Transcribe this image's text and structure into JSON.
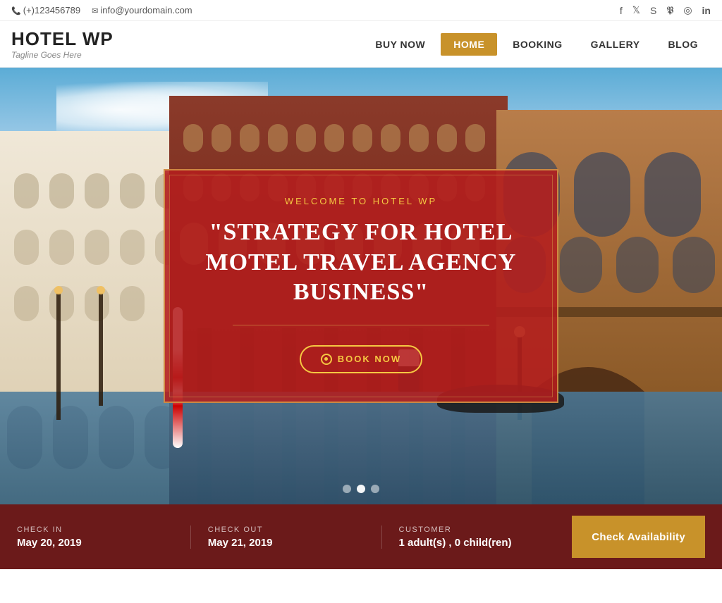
{
  "topbar": {
    "phone": "(+)123456789",
    "email": "info@yourdomain.com",
    "social": [
      {
        "name": "facebook",
        "symbol": "f"
      },
      {
        "name": "twitter",
        "symbol": "𝕏"
      },
      {
        "name": "skype",
        "symbol": "S"
      },
      {
        "name": "pinterest",
        "symbol": "P"
      },
      {
        "name": "instagram",
        "symbol": "⊙"
      },
      {
        "name": "linkedin",
        "symbol": "in"
      }
    ]
  },
  "header": {
    "logo_title": "HOTEL WP",
    "logo_tagline": "Tagline Goes Here",
    "nav": [
      {
        "label": "BUY NOW",
        "active": false
      },
      {
        "label": "HOME",
        "active": true
      },
      {
        "label": "BOOKING",
        "active": false
      },
      {
        "label": "GALLERY",
        "active": false
      },
      {
        "label": "BLOG",
        "active": false
      }
    ]
  },
  "hero": {
    "subtitle": "WELCOME TO HOTEL WP",
    "title": "\"STRATEGY FOR HOTEL MOTEL TRAVEL AGENCY BUSINESS\"",
    "book_btn": "BOOK NOW",
    "dots": [
      {
        "active": false
      },
      {
        "active": true
      },
      {
        "active": false
      }
    ]
  },
  "booking": {
    "checkin_label": "CHECK IN",
    "checkin_value": "May 20, 2019",
    "checkout_label": "CHECK OUT",
    "checkout_value": "May 21, 2019",
    "customer_label": "CUSTOMER",
    "customer_value": "1 adult(s) , 0 child(ren)",
    "cta_label": "Check Availability"
  }
}
